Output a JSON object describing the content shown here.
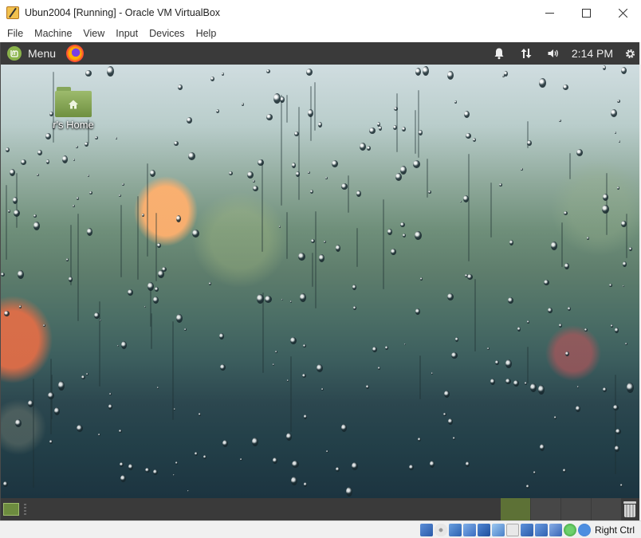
{
  "window": {
    "title": "Ubun2004 [Running] - Oracle VM VirtualBox"
  },
  "menubar": {
    "items": [
      "File",
      "Machine",
      "View",
      "Input",
      "Devices",
      "Help"
    ]
  },
  "guest": {
    "top_panel": {
      "menu_label": "Menu",
      "clock": "2:14 PM"
    },
    "desktop": {
      "icons": [
        {
          "label": "r's Home",
          "icon": "home-folder-icon"
        }
      ]
    },
    "bottom_panel": {
      "workspaces": 4,
      "active_workspace": 1
    }
  },
  "statusbar": {
    "host_key_label": "Right Ctrl",
    "icons": [
      "hard-disk-icon",
      "optical-drive-icon",
      "audio-icon",
      "network-icon",
      "usb-icon",
      "shared-folder-icon",
      "display-icon",
      "video-capture-icon",
      "cpu-icon",
      "mouse-integration-icon",
      "keyboard-capture-icon",
      "arrow-down-icon"
    ]
  },
  "colors": {
    "mint_green": "#8ab34b",
    "panel": "#3a3a3a",
    "active_workspace": "#5d7136"
  }
}
